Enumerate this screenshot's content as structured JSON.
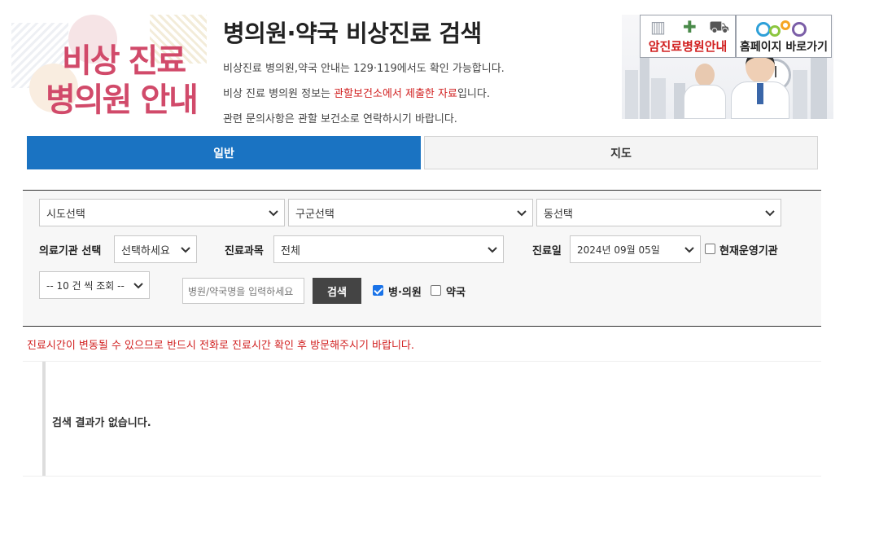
{
  "logo": {
    "line1": "비상 진료",
    "line2": "병의원 안내"
  },
  "header": {
    "title": "병의원·약국 비상진료 검색",
    "info_1": "비상진료 병의원,약국 안내는 129·119에서도 확인 가능합니다.",
    "info_2_prefix": "비상 진료 병의원 정보는 ",
    "info_2_highlight": "관할보건소에서 제출한 자료",
    "info_2_suffix": "입니다.",
    "info_3": "관련 문의사항은 관할 보건소로 연락하시기 바랍니다."
  },
  "banner": {
    "cancer_label": "암진료병원안내",
    "home_label": "홈페이지 바로가기"
  },
  "tabs": {
    "general": "일반",
    "map": "지도"
  },
  "search": {
    "sido": "시도선택",
    "gugun": "구군선택",
    "dong": "동선택",
    "institution_label": "의료기관 선택",
    "institution_value": "선택하세요",
    "department_label": "진료과목",
    "department_value": "전체",
    "date_label": "진료일",
    "date_value": "2024년 09월 05일",
    "operating_label": "현재운영기관",
    "operating_checked": false,
    "page_size": "-- 10 건 씩 조회 --",
    "name_placeholder": "병원/약국명을 입력하세요",
    "search_button": "검색",
    "hospital_label": "병·의원",
    "hospital_checked": true,
    "pharmacy_label": "약국",
    "pharmacy_checked": false
  },
  "notice": "진료시간이 변동될 수 있으므로 반드시 전화로 진료시간 확인 후 방문해주시기 바랍니다.",
  "results": {
    "empty_message": "검색 결과가 없습니다."
  },
  "colors": {
    "accent": "#1a73c2",
    "alert": "#d11f1f",
    "logo": "#d14a6a"
  }
}
